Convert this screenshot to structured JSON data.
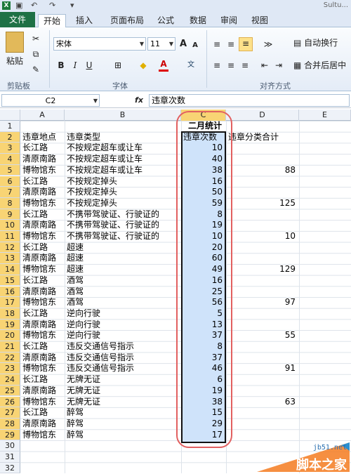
{
  "title_bar": {
    "app_text": "Sultu..."
  },
  "tabs": {
    "file": "文件",
    "home": "开始",
    "insert": "插入",
    "layout": "页面布局",
    "formula": "公式",
    "data": "数据",
    "review": "审阅",
    "view": "视图"
  },
  "ribbon": {
    "paste": "粘贴",
    "clipboard": "剪贴板",
    "font_name": "宋体",
    "font_size": "11",
    "bold": "B",
    "italic": "I",
    "underline": "U",
    "font_group": "字体",
    "align_group": "对齐方式",
    "wrap": "自动换行",
    "merge": "合并后居中",
    "a_plus": "A",
    "a_minus": "A",
    "font_color": "A"
  },
  "formula_bar": {
    "name_box": "C2",
    "fx": "fx",
    "content": "违章次数"
  },
  "columns": [
    "A",
    "B",
    "C",
    "D",
    "E"
  ],
  "rows": [
    "1",
    "2",
    "3",
    "4",
    "5",
    "6",
    "7",
    "8",
    "9",
    "10",
    "11",
    "12",
    "13",
    "14",
    "15",
    "16",
    "17",
    "18",
    "19",
    "20",
    "21",
    "22",
    "23",
    "24",
    "25",
    "26",
    "27",
    "28",
    "29",
    "30",
    "31",
    "32"
  ],
  "sheet": {
    "title": "二月统计",
    "headers": [
      "违章地点",
      "违章类型",
      "违章次数",
      "违章分类合计"
    ],
    "data": [
      [
        "长江路",
        "不按规定超车或让车",
        "10",
        ""
      ],
      [
        "清原南路",
        "不按规定超车或让车",
        "40",
        ""
      ],
      [
        "博物馆东",
        "不按规定超车或让车",
        "38",
        "88"
      ],
      [
        "长江路",
        "不按规定掉头",
        "16",
        ""
      ],
      [
        "清原南路",
        "不按规定掉头",
        "50",
        ""
      ],
      [
        "博物馆东",
        "不按规定掉头",
        "59",
        "125"
      ],
      [
        "长江路",
        "不携带驾驶证、行驶证的",
        "8",
        ""
      ],
      [
        "清原南路",
        "不携带驾驶证、行驶证的",
        "19",
        ""
      ],
      [
        "博物馆东",
        "不携带驾驶证、行驶证的",
        "10",
        "10"
      ],
      [
        "长江路",
        "超速",
        "20",
        ""
      ],
      [
        "清原南路",
        "超速",
        "60",
        ""
      ],
      [
        "博物馆东",
        "超速",
        "49",
        "129"
      ],
      [
        "长江路",
        "酒驾",
        "16",
        ""
      ],
      [
        "清原南路",
        "酒驾",
        "25",
        ""
      ],
      [
        "博物馆东",
        "酒驾",
        "56",
        "97"
      ],
      [
        "长江路",
        "逆向行驶",
        "5",
        ""
      ],
      [
        "清原南路",
        "逆向行驶",
        "13",
        ""
      ],
      [
        "博物馆东",
        "逆向行驶",
        "37",
        "55"
      ],
      [
        "长江路",
        "违反交通信号指示",
        "8",
        ""
      ],
      [
        "清原南路",
        "违反交通信号指示",
        "37",
        ""
      ],
      [
        "博物馆东",
        "违反交通信号指示",
        "46",
        "91"
      ],
      [
        "长江路",
        "无牌无证",
        "6",
        ""
      ],
      [
        "清原南路",
        "无牌无证",
        "19",
        ""
      ],
      [
        "博物馆东",
        "无牌无证",
        "38",
        "63"
      ],
      [
        "长江路",
        "醉驾",
        "15",
        ""
      ],
      [
        "清原南路",
        "醉驾",
        "29",
        ""
      ],
      [
        "博物馆东",
        "醉驾",
        "17",
        ""
      ]
    ]
  },
  "watermark": {
    "site": "jb51.net",
    "name": "脚本之家"
  }
}
